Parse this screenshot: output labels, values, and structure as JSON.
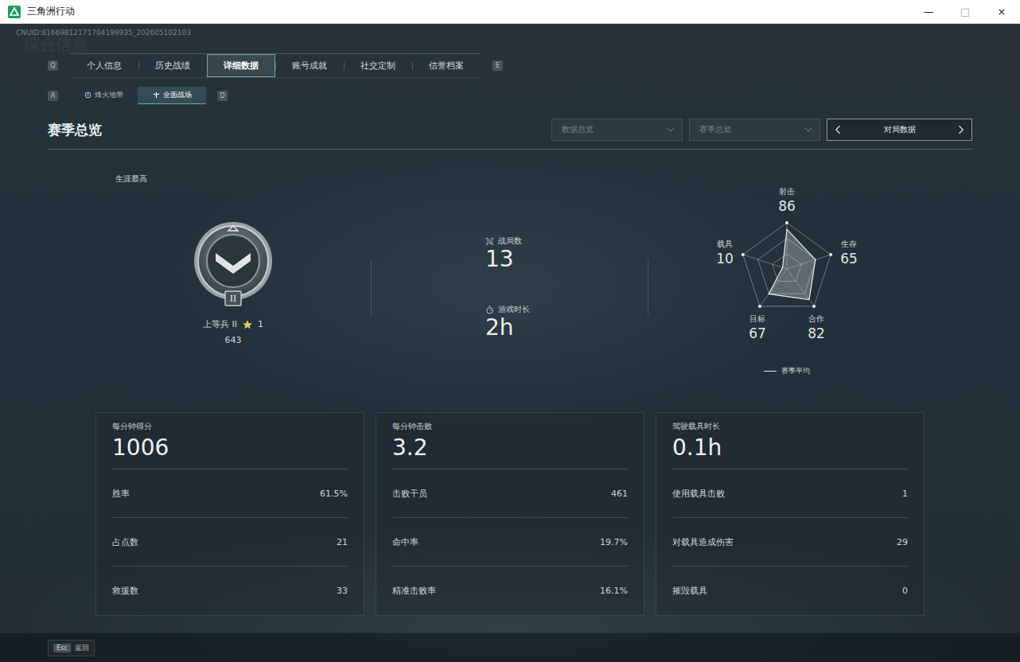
{
  "window": {
    "title": "三角洲行动",
    "controls": [
      "—",
      "□",
      "×"
    ]
  },
  "account_id": "CNUID:81669812171704199935_202605102103",
  "watermark": "综合信息",
  "main_tabs": {
    "prev_key": "Q",
    "next_key": "E",
    "items": [
      {
        "label": "个人信息",
        "selected": false
      },
      {
        "label": "历史战绩",
        "selected": false
      },
      {
        "label": "详细数据",
        "selected": true
      },
      {
        "label": "账号成就",
        "selected": false
      },
      {
        "label": "社交定制",
        "selected": false
      },
      {
        "label": "信誉档案",
        "selected": false
      }
    ]
  },
  "mode_tabs": {
    "prev_key": "A",
    "next_key": "D",
    "items": [
      {
        "label": "烽火地带",
        "selected": false,
        "kind": "extraction"
      },
      {
        "label": "全面战场",
        "selected": true,
        "kind": "warfare"
      }
    ]
  },
  "section_title": "赛季总览",
  "filters": [
    {
      "label": "数据总览"
    },
    {
      "label": "赛季总览"
    }
  ],
  "stepper": {
    "label": "对局数据"
  },
  "career": {
    "label": "生涯最高",
    "badge_tier": "II",
    "rank": "上等兵 II",
    "stars": "1",
    "points": "643"
  },
  "summary": [
    {
      "label": "战局数",
      "value": "13",
      "kind": "matches"
    },
    {
      "label": "游戏时长",
      "value": "2h",
      "kind": "time"
    }
  ],
  "radar": {
    "axes": [
      {
        "label": "射击",
        "reading": "86"
      },
      {
        "label": "生存",
        "reading": "65"
      },
      {
        "label": "合作",
        "reading": "82"
      },
      {
        "label": "目标",
        "reading": "67"
      },
      {
        "label": "载具",
        "reading": "10"
      }
    ],
    "series": [
      {
        "name": "赛季平均",
        "values": [
          86,
          65,
          82,
          67,
          10
        ]
      }
    ]
  },
  "cards": [
    {
      "title": "每分钟得分",
      "value": "1006",
      "rows": [
        {
          "label": "胜率",
          "value": "61.5%"
        },
        {
          "label": "占点数",
          "value": "21"
        },
        {
          "label": "救援数",
          "value": "33"
        }
      ]
    },
    {
      "title": "每分钟击败",
      "value": "3.2",
      "rows": [
        {
          "label": "击败干员",
          "value": "461"
        },
        {
          "label": "命中率",
          "value": "19.7%"
        },
        {
          "label": "精准击败率",
          "value": "16.1%"
        }
      ]
    },
    {
      "title": "驾驶载具时长",
      "value": "0.1h",
      "rows": [
        {
          "label": "使用载具击败",
          "value": "1"
        },
        {
          "label": "对载具造成伤害",
          "value": "29"
        },
        {
          "label": "摧毁载具",
          "value": "0"
        }
      ]
    }
  ],
  "footer": {
    "key": "Esc",
    "label": "返回"
  }
}
